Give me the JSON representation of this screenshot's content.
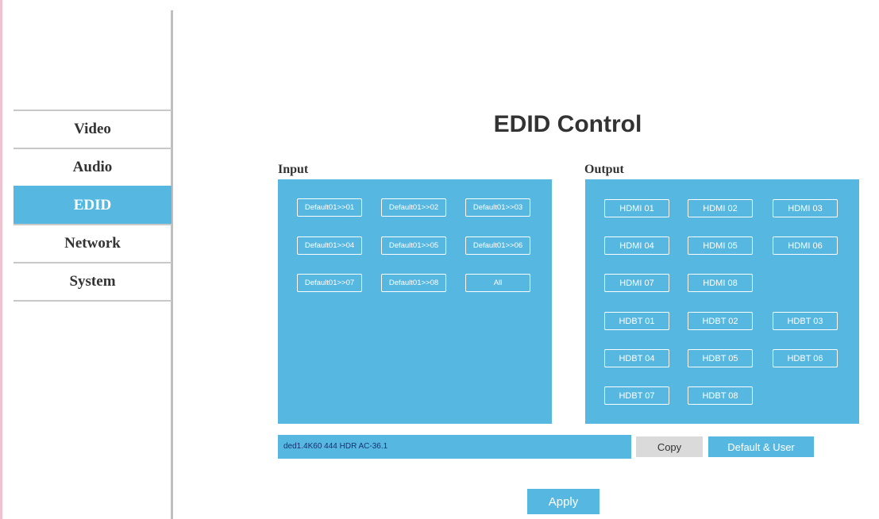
{
  "nav": {
    "items": [
      {
        "label": "Video",
        "active": false
      },
      {
        "label": "Audio",
        "active": false
      },
      {
        "label": "EDID",
        "active": true
      },
      {
        "label": "Network",
        "active": false
      },
      {
        "label": "System",
        "active": false
      }
    ]
  },
  "page": {
    "title": "EDID Control"
  },
  "input": {
    "label": "Input",
    "buttons": [
      "Default01>>01",
      "Default01>>02",
      "Default01>>03",
      "Default01>>04",
      "Default01>>05",
      "Default01>>06",
      "Default01>>07",
      "Default01>>08",
      "All"
    ]
  },
  "output": {
    "label": "Output",
    "buttons": [
      "HDMI 01",
      "HDMI 02",
      "HDMI 03",
      "HDMI 04",
      "HDMI 05",
      "HDMI 06",
      "HDMI 07",
      "HDMI 08",
      "HDBT 01",
      "HDBT 02",
      "HDBT 03",
      "HDBT 04",
      "HDBT 05",
      "HDBT 06",
      "HDBT 07",
      "HDBT 08"
    ]
  },
  "edid_field": {
    "value": "ded1.4K60 444 HDR AC-36.1"
  },
  "actions": {
    "copy": "Copy",
    "default_user": "Default & User",
    "apply": "Apply"
  },
  "colors": {
    "accent": "#56b8e1",
    "copy_bg": "#dadada",
    "text": "#333333"
  }
}
